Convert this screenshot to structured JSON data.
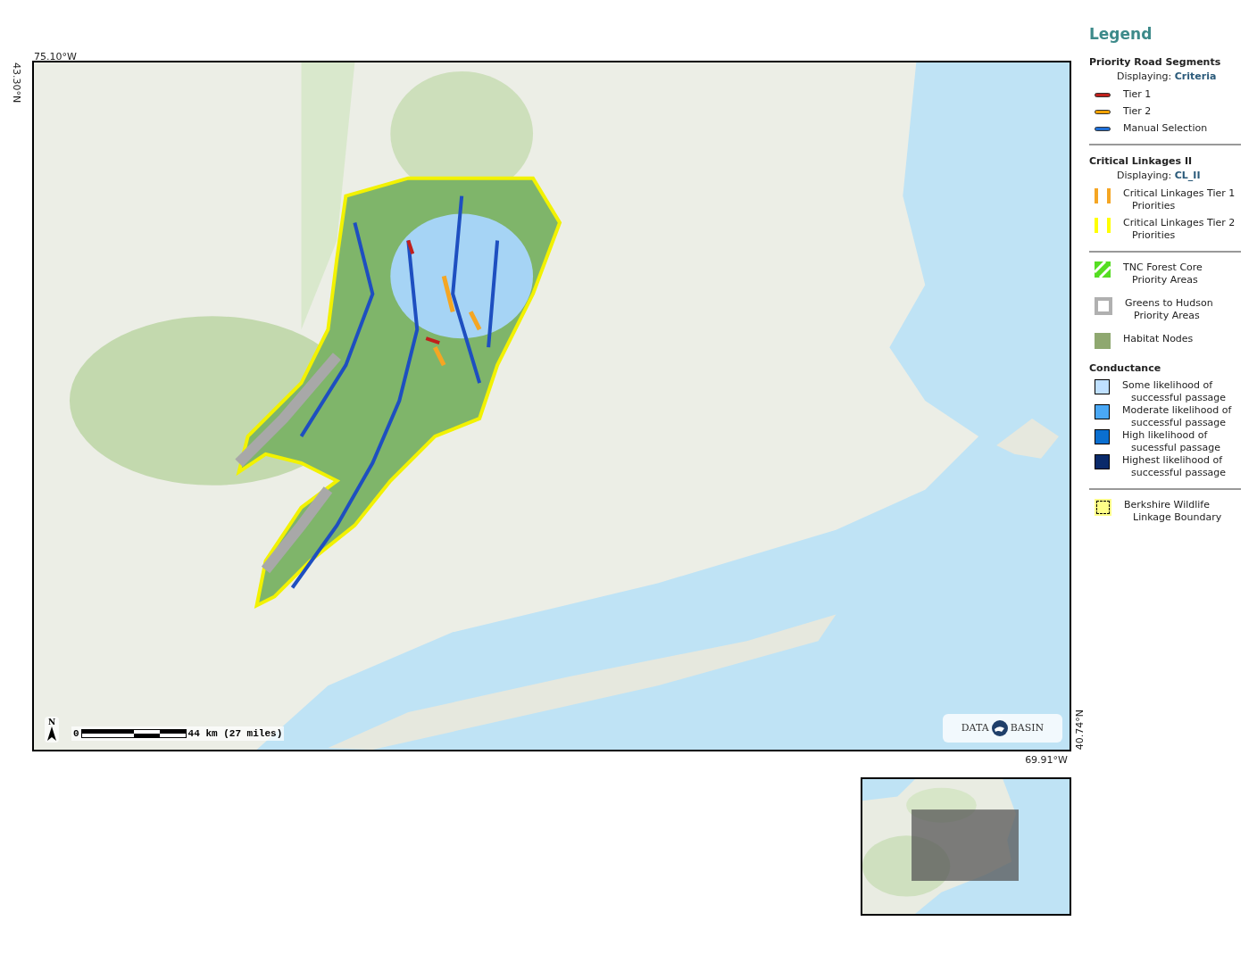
{
  "map": {
    "top_left_longitude": "75.10°W",
    "top_left_latitude": "43.30°N",
    "bottom_right_latitude": "40.74°N",
    "bottom_right_longitude": "69.91°W",
    "north_arrow": "N",
    "scale_bar": {
      "start": "0",
      "label": "44 km (27 miles)"
    },
    "logo": {
      "left": "DATA",
      "right": "BASIN"
    }
  },
  "legend": {
    "title": "Legend",
    "sections": [
      {
        "heading": "Priority Road Segments",
        "displaying_label": "Displaying:",
        "displaying_value": "Criteria",
        "divider_after": true,
        "items": [
          {
            "kind": "road",
            "lines": [
              "Tier 1"
            ],
            "color": "#c0201c"
          },
          {
            "kind": "road",
            "lines": [
              "Tier 2"
            ],
            "color": "#f5a300"
          },
          {
            "kind": "road",
            "lines": [
              "Manual Selection"
            ],
            "color": "#1e6fd8"
          }
        ]
      },
      {
        "heading": "Critical Linkages II",
        "displaying_label": "Displaying:",
        "displaying_value": "CL_II",
        "divider_after": true,
        "items": [
          {
            "kind": "bars",
            "lines": [
              "Critical Linkages Tier 1",
              "Priorities"
            ],
            "color": "#f5a623"
          },
          {
            "kind": "bars",
            "lines": [
              "Critical Linkages Tier 2",
              "Priorities"
            ],
            "color": "#ffff00"
          }
        ]
      },
      {
        "divider_after": false,
        "items": [
          {
            "kind": "hatch",
            "lines": [
              "TNC Forest Core",
              "Priority Areas"
            ],
            "color": "#55dd22"
          },
          {
            "kind": "outline",
            "lines": [
              "Greens to Hudson",
              "Priority Areas"
            ],
            "color": "#b0b0b0"
          },
          {
            "kind": "fill",
            "lines": [
              "Habitat Nodes"
            ],
            "color": "#8fa870"
          }
        ]
      },
      {
        "heading": "Conductance",
        "divider_after": true,
        "items": [
          {
            "kind": "box",
            "lines": [
              "Some likelihood of",
              "successful passage"
            ],
            "color": "#bfe0ff"
          },
          {
            "kind": "box",
            "lines": [
              "Moderate likelihood of",
              "successful passage"
            ],
            "color": "#4aa8f5"
          },
          {
            "kind": "box",
            "lines": [
              "High likelihood of",
              "sucessful passage"
            ],
            "color": "#0a6fd0"
          },
          {
            "kind": "box",
            "lines": [
              "Highest likelihood of",
              "successful passage"
            ],
            "color": "#0a2a6a"
          }
        ]
      },
      {
        "divider_after": false,
        "items": [
          {
            "kind": "dashed",
            "lines": [
              "Berkshire Wildlife",
              "Linkage Boundary"
            ],
            "color": "#ffff88"
          }
        ]
      }
    ]
  }
}
